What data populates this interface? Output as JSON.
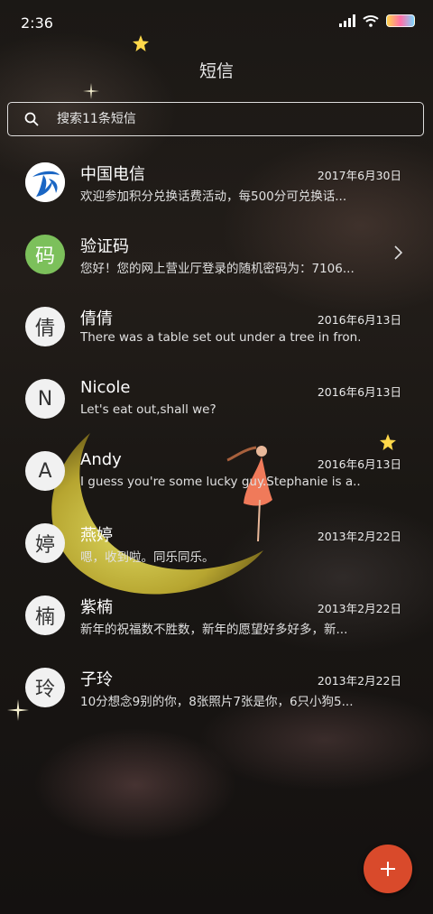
{
  "status_bar": {
    "time": "2:36"
  },
  "header": {
    "title": "短信"
  },
  "search": {
    "placeholder": "搜索11条短信"
  },
  "conversations": [
    {
      "avatar": "",
      "avatar_icon": "china-telecom-logo-icon",
      "name": "中国电信",
      "date": "2017年6月30日",
      "preview": "欢迎参加积分兑换话费活动，每500分可兑换话..."
    },
    {
      "avatar": "码",
      "name": "验证码",
      "date": "",
      "preview": "您好！您的网上营业厅登录的随机密码为：7106..."
    },
    {
      "avatar": "倩",
      "name": "倩倩",
      "date": "2016年6月13日",
      "preview": "There was a table set out under a tree in fron..."
    },
    {
      "avatar": "N",
      "name": "Nicole",
      "date": "2016年6月13日",
      "preview": "Let's eat out,shall we?"
    },
    {
      "avatar": "A",
      "name": "Andy",
      "date": "2016年6月13日",
      "preview": "I guess you're some lucky guy.Stephanie is a..."
    },
    {
      "avatar": "婷",
      "name": "燕婷",
      "date": "2013年2月22日",
      "preview": "嗯，收到啦。同乐同乐。"
    },
    {
      "avatar": "楠",
      "name": "紫楠",
      "date": "2013年2月22日",
      "preview": "新年的祝福数不胜数，新年的愿望好多好多，新..."
    },
    {
      "avatar": "玲",
      "name": "子玲",
      "date": "2013年2月22日",
      "preview": "10分想念9别的你，8张照片7张是你，6只小狗5..."
    }
  ],
  "fab": {
    "icon": "plus-icon"
  },
  "colors": {
    "fab": "#d94a2b",
    "verification_avatar": "#7cc05b",
    "telecom_blue": "#1a66c4"
  }
}
